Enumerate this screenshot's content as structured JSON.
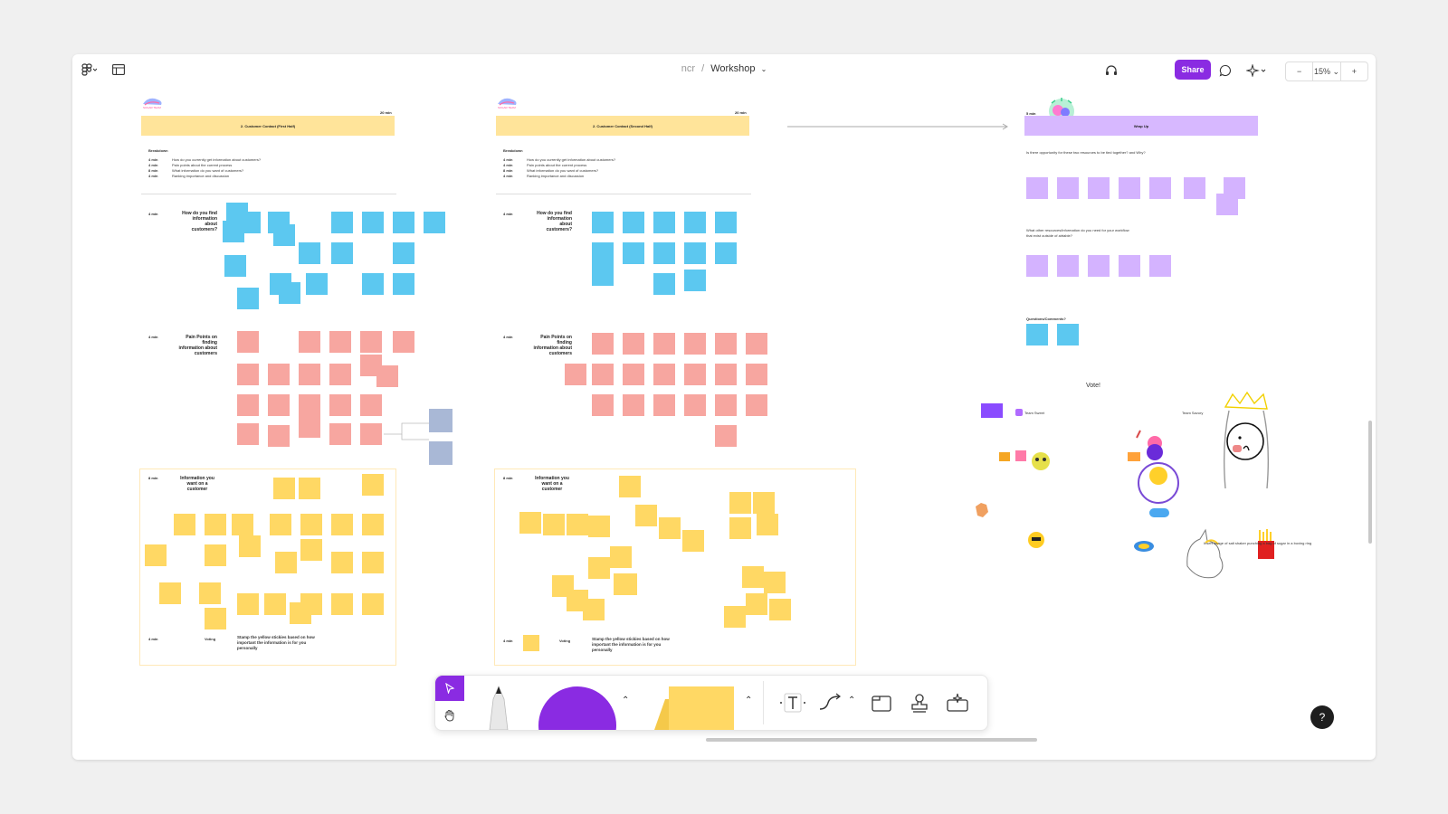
{
  "header": {
    "breadcrumb_parent": "ncr",
    "breadcrumb_separator": "/",
    "file_name": "Workshop",
    "share_label": "Share",
    "zoom_level": "15%",
    "zoom_out_label": "−",
    "zoom_in_label": "+"
  },
  "section1": {
    "logo": "SUGAR TEAM",
    "time": "20 min",
    "title": "2. Customer Contact (First Half)",
    "breakdown_title": "Breakdown",
    "breakdown": [
      {
        "time": "4 min",
        "text": "How do you currently get information about customers?"
      },
      {
        "time": "4 min",
        "text": "Pain points about the current process"
      },
      {
        "time": "8 min",
        "text": "What information do you want of customers?"
      },
      {
        "time": "4 min",
        "text": "Ranking importance and discussion"
      }
    ],
    "row1_time": "4 min",
    "row1_label": "How do you find information about customers?",
    "row2_time": "4 min",
    "row2_label": "Pain Points on finding information about customers",
    "row3_time": "8 min",
    "row3_label": "Information you want on a customer",
    "row4_time": "4 min",
    "row4_label": "Voting",
    "voting_text": "Stamp the yellow stickies based on how important the information is for you personally"
  },
  "section2": {
    "logo": "SUGAR TEAM",
    "time": "20 min",
    "title": "2. Customer Contact (Second Half)",
    "breakdown_title": "Breakdown",
    "breakdown": [
      {
        "time": "4 min",
        "text": "How do you currently get information about customers?"
      },
      {
        "time": "4 min",
        "text": "Pain points about the current process"
      },
      {
        "time": "8 min",
        "text": "What information do you want of customers?"
      },
      {
        "time": "4 min",
        "text": "Ranking importance and discussion"
      }
    ],
    "row1_time": "4 min",
    "row1_label": "How do you find information about customers?",
    "row2_time": "4 min",
    "row2_label": "Pain Points on finding information about customers",
    "row3_time": "8 min",
    "row3_label": "Information you want on a customer",
    "row4_time": "4 min",
    "row4_label": "Voting",
    "voting_text": "Stamp the yellow stickies based on how important the information is for you personally"
  },
  "wrapup": {
    "time": "5 min",
    "title": "Wrap Up",
    "q1": "Is there opportunity for these two resources to be tied together? and Why?",
    "q2": "What other resources/information do you need for your workflow that exist outside of airtable?",
    "q3": "Questions/Comments?"
  },
  "vote": {
    "title": "Vote!",
    "team_sweet": "Team Sweet",
    "team_savory": "Team Savory",
    "caption": "Insert image of salt shaker punching a bag of sugar in a boxing ring"
  },
  "help_label": "?"
}
